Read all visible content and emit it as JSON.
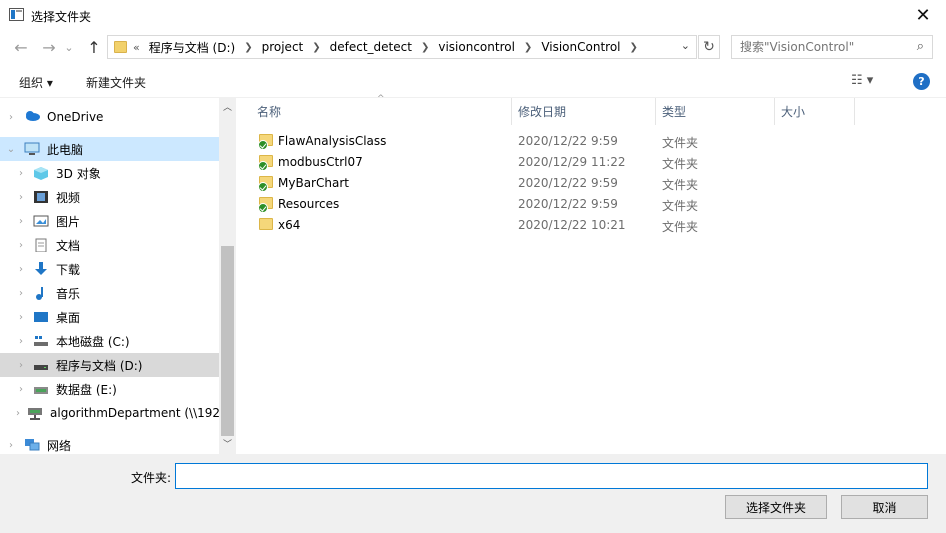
{
  "window": {
    "title": "选择文件夹",
    "close": "✕"
  },
  "nav": {
    "back": "←",
    "forward": "→",
    "recent": "⌄",
    "up": "↑",
    "lead": "«",
    "path": [
      "程序与文档 (D:)",
      "project",
      "defect_detect",
      "visioncontrol",
      "VisionControl"
    ],
    "dropdown": "⌄",
    "refresh": "↻",
    "search_placeholder": "搜索\"VisionControl\"",
    "search_icon": "⌕"
  },
  "toolbar": {
    "organize": "组织 ▾",
    "new_folder": "新建文件夹",
    "view": "☷ ▾",
    "help": "?"
  },
  "sidebar": {
    "items": [
      {
        "label": "OneDrive",
        "icon": "cloud-icon"
      },
      {
        "label": "此电脑",
        "icon": "computer-icon"
      },
      {
        "label": "3D 对象",
        "icon": "cube-icon"
      },
      {
        "label": "视频",
        "icon": "video-icon"
      },
      {
        "label": "图片",
        "icon": "picture-icon"
      },
      {
        "label": "文档",
        "icon": "document-icon"
      },
      {
        "label": "下载",
        "icon": "download-icon"
      },
      {
        "label": "音乐",
        "icon": "music-icon"
      },
      {
        "label": "桌面",
        "icon": "desktop-icon"
      },
      {
        "label": "本地磁盘 (C:)",
        "icon": "drive-icon"
      },
      {
        "label": "程序与文档 (D:)",
        "icon": "drive-icon"
      },
      {
        "label": "数据盘 (E:)",
        "icon": "drive-icon"
      },
      {
        "label": "algorithmDepartment (\\\\192",
        "icon": "network-drive-icon"
      },
      {
        "label": "网络",
        "icon": "network-icon"
      }
    ],
    "scroll_up": "︿",
    "scroll_down": "﹀"
  },
  "columns": {
    "name": "名称",
    "modified": "修改日期",
    "type": "类型",
    "size": "大小",
    "sort_indicator": "^"
  },
  "files": [
    {
      "name": "FlawAnalysisClass",
      "date": "2020/12/22 9:59",
      "type": "文件夹",
      "synced": true
    },
    {
      "name": "modbusCtrl07",
      "date": "2020/12/29 11:22",
      "type": "文件夹",
      "synced": true
    },
    {
      "name": "MyBarChart",
      "date": "2020/12/22 9:59",
      "type": "文件夹",
      "synced": true
    },
    {
      "name": "Resources",
      "date": "2020/12/22 9:59",
      "type": "文件夹",
      "synced": true
    },
    {
      "name": "x64",
      "date": "2020/12/22 10:21",
      "type": "文件夹",
      "synced": false
    }
  ],
  "footer": {
    "folder_label": "文件夹:",
    "folder_value": "",
    "select_button": "选择文件夹",
    "cancel_button": "取消"
  },
  "colors": {
    "accent": "#0078d7",
    "selected_bg": "#cce8ff",
    "highlight_bg": "#d9d9d9",
    "folder": "#f5d77a"
  }
}
